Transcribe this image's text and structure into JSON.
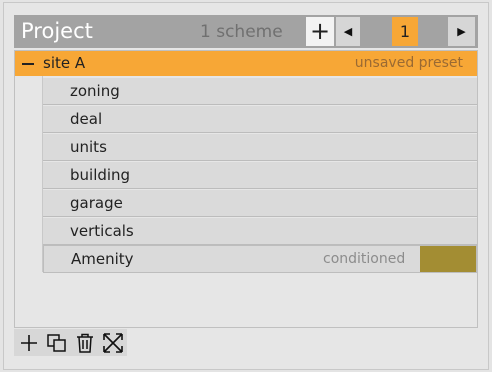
{
  "header": {
    "title": "Project",
    "scheme_count": "1 scheme",
    "add_symbol": "+",
    "prev_symbol": "◀",
    "next_symbol": "▶",
    "page": "1"
  },
  "site": {
    "label": "site A",
    "status": "unsaved preset"
  },
  "children": [
    {
      "label": "zoning"
    },
    {
      "label": "deal"
    },
    {
      "label": "units"
    },
    {
      "label": "building"
    },
    {
      "label": "garage"
    },
    {
      "label": "verticals"
    },
    {
      "label": "Amenity",
      "status": "conditioned"
    }
  ],
  "colors": {
    "accent": "#f7a736",
    "amenity_swatch": "#a38d33",
    "header_bg": "#a3a3a3"
  },
  "footer": {
    "icons": [
      "add-icon",
      "duplicate-icon",
      "trash-icon",
      "expand-icon"
    ]
  }
}
